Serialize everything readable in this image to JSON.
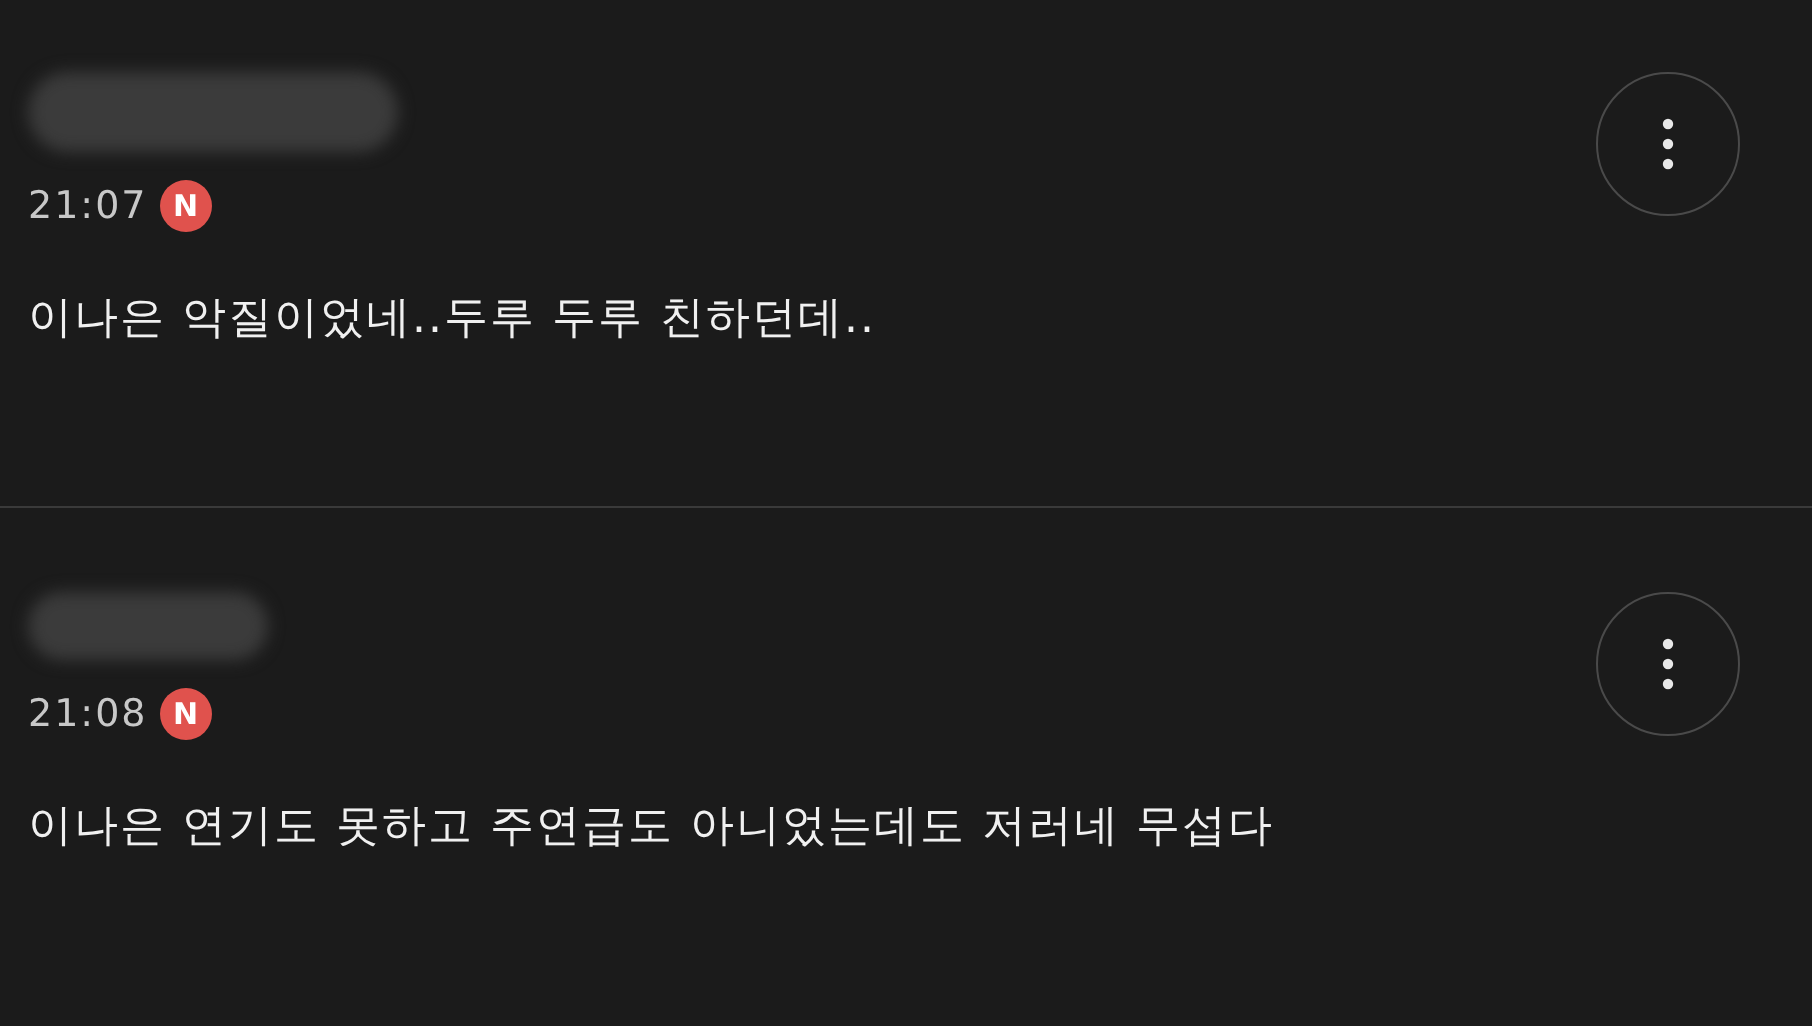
{
  "comments": [
    {
      "name_hidden": true,
      "time": "21:07",
      "new_badge": "N",
      "text": "이나은 악질이었네..두루 두루 친하던데.."
    },
    {
      "name_hidden": true,
      "time": "21:08",
      "new_badge": "N",
      "text": "이나은 연기도 못하고 주연급도 아니었는데도 저러네 무섭다"
    }
  ]
}
